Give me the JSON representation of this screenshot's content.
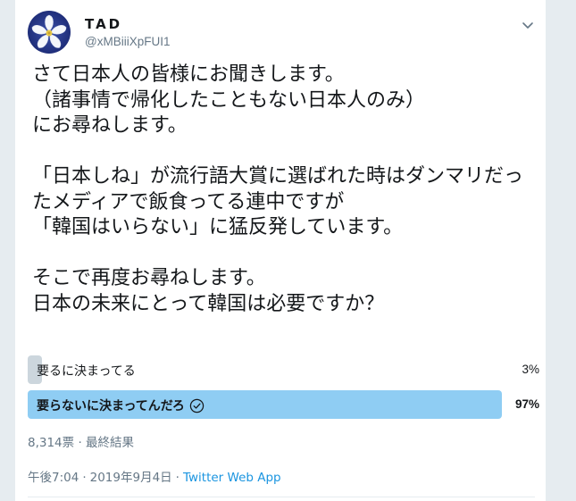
{
  "tweet": {
    "display_name": "TAD",
    "handle": "@xMBiiiXpFUI1",
    "text": "さて日本人の皆様にお聞きします。\n（諸事情で帰化したこともない日本人のみ）\nにお尋ねします。\n\n「日本しね」が流行語大賞に選ばれた時はダンマリだったメディアで飯食ってる連中ですが\n「韓国はいらない」に猛反発しています。\n\nそこで再度お尋ねします。\n日本の未来にとって韓国は必要ですか？"
  },
  "poll": {
    "options": [
      {
        "label": "要るに決まってる",
        "percent": "3%",
        "value": 3,
        "winner": false
      },
      {
        "label": "要らないに決まってんだろ",
        "percent": "97%",
        "value": 97,
        "winner": true
      }
    ],
    "meta": "8,314票 · 最終結果"
  },
  "footer": {
    "time": "午後7:04",
    "date": "2019年9月4日",
    "separator": "·",
    "app": "Twitter Web App"
  },
  "colors": {
    "winner_bar": "#8fcdf3",
    "loser_bar": "#ccd6dd",
    "link": "#1b95e0",
    "muted": "#657786"
  },
  "icons": {
    "avatar": "cherry-blossom",
    "menu": "chevron-down-icon",
    "winner": "check-circle-icon"
  }
}
